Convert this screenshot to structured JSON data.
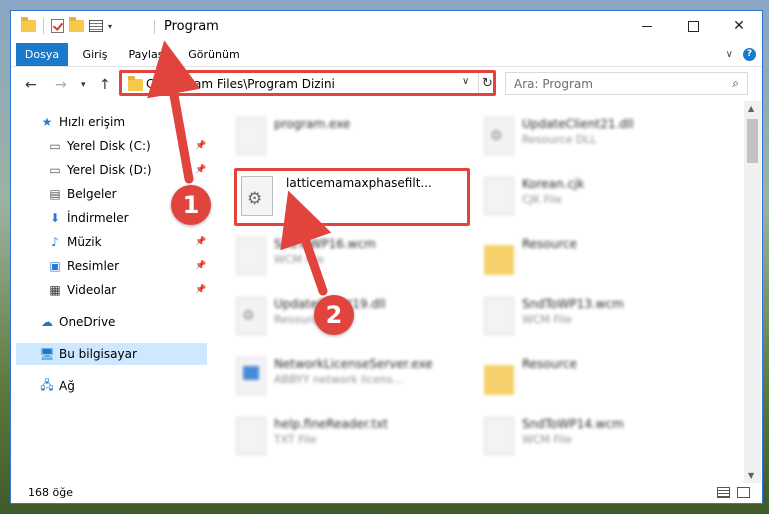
{
  "window": {
    "title": "Program"
  },
  "ribbon": {
    "tabs": [
      "Dosya",
      "Giriş",
      "Paylaş",
      "Görünüm"
    ]
  },
  "nav": {
    "address": "C:\\Program Files\\Program Dizini",
    "search_placeholder": "Ara: Program"
  },
  "sidebar": {
    "items": [
      {
        "label": "Hızlı erişim",
        "icon": "star-icon"
      },
      {
        "label": "Yerel Disk (C:)",
        "icon": "drive-icon"
      },
      {
        "label": "Yerel Disk (D:)",
        "icon": "drive-icon"
      },
      {
        "label": "Belgeler",
        "icon": "documents-icon"
      },
      {
        "label": "İndirmeler",
        "icon": "download-icon"
      },
      {
        "label": "Müzik",
        "icon": "music-icon"
      },
      {
        "label": "Resimler",
        "icon": "pictures-icon"
      },
      {
        "label": "Videolar",
        "icon": "videos-icon"
      },
      {
        "label": "OneDrive",
        "icon": "cloud-icon"
      },
      {
        "label": "Bu bilgisayar",
        "icon": "computer-icon"
      },
      {
        "label": "Ağ",
        "icon": "network-icon"
      }
    ]
  },
  "files": [
    {
      "name": "program.exe",
      "desc": ""
    },
    {
      "name": "UpdateClient21.dll",
      "desc": "Resource DLL"
    },
    {
      "name": "Korean.cjk",
      "desc": "CJK File"
    },
    {
      "name": "SndToWP16.wcm",
      "desc": "WCM File"
    },
    {
      "name": "Resource",
      "desc": ""
    },
    {
      "name": "UpdateClient19.dll",
      "desc": "Resource DLL"
    },
    {
      "name": "SndToWP13.wcm",
      "desc": "WCM File"
    },
    {
      "name": "NetworkLicenseServer.exe",
      "desc": "ABBYY network licens..."
    },
    {
      "name": "Resource",
      "desc": ""
    },
    {
      "name": "help.fineReader.txt",
      "desc": "TXT File"
    },
    {
      "name": "SndToWP14.wcm",
      "desc": "WCM File"
    }
  ],
  "focus_file": {
    "name": "latticemamaxphasefilt..."
  },
  "status": {
    "count": "168 öğe"
  },
  "annotations": {
    "step1": "1",
    "step2": "2"
  },
  "colors": {
    "accent": "#1979ca",
    "highlight": "#e0443d"
  }
}
